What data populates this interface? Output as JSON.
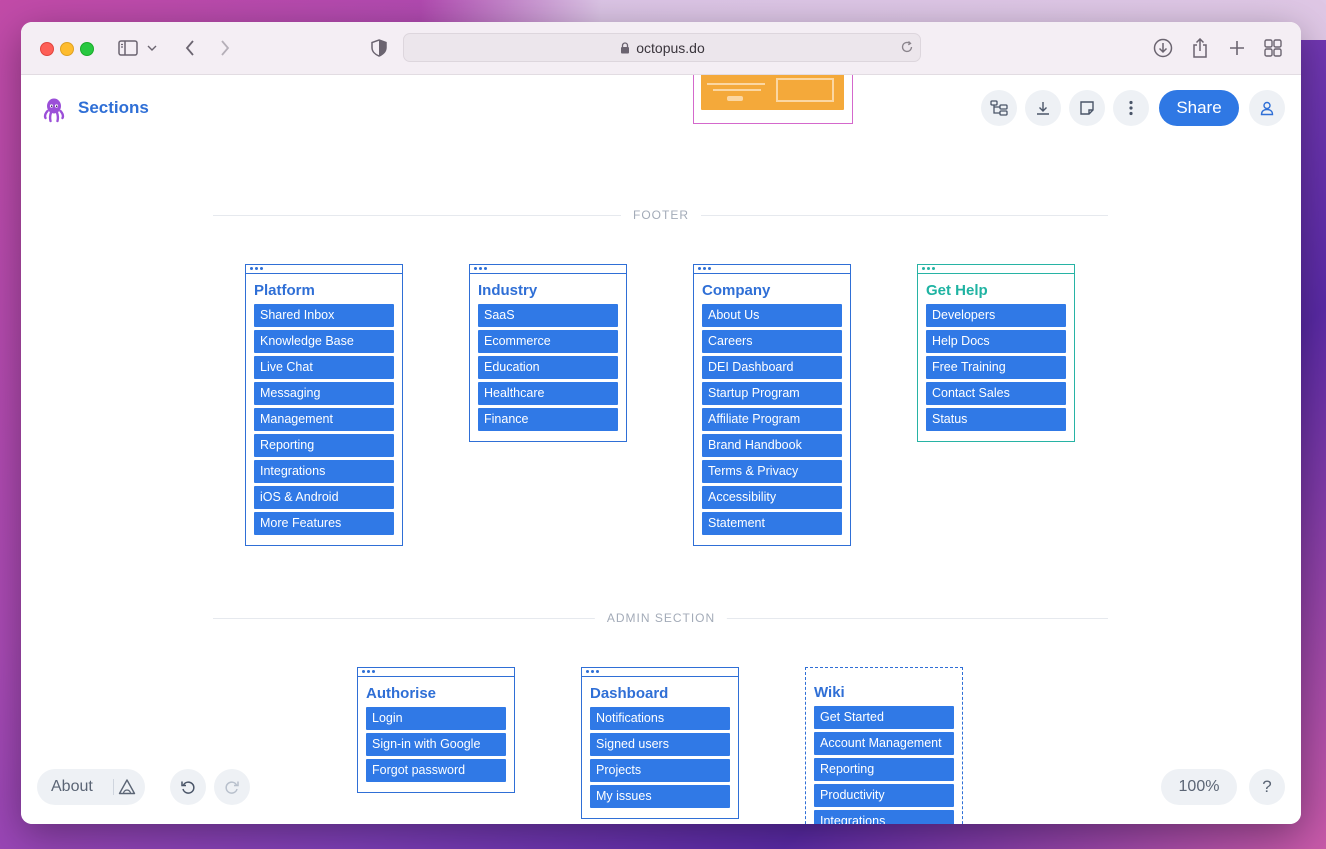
{
  "browser": {
    "url": "octopus.do"
  },
  "app": {
    "title": "Sections",
    "share_label": "Share"
  },
  "sections": {
    "footer_label": "FOOTER",
    "admin_label": "ADMIN SECTION"
  },
  "footer_cards": [
    {
      "title": "Platform",
      "items": [
        "Shared Inbox",
        "Knowledge Base",
        "Live Chat",
        "Messaging",
        "Management",
        "Reporting",
        "Integrations",
        "iOS & Android",
        "More Features"
      ]
    },
    {
      "title": "Industry",
      "items": [
        "SaaS",
        "Ecommerce",
        "Education",
        "Healthcare",
        "Finance"
      ]
    },
    {
      "title": "Company",
      "items": [
        "About Us",
        "Careers",
        "DEI Dashboard",
        "Startup Program",
        "Affiliate Program",
        "Brand Handbook",
        "Terms & Privacy",
        "Accessibility",
        "Statement"
      ]
    },
    {
      "title": "Get Help",
      "items": [
        "Developers",
        "Help Docs",
        "Free Training",
        "Contact Sales",
        "Status"
      ]
    }
  ],
  "admin_cards": [
    {
      "title": "Authorise",
      "items": [
        "Login",
        "Sign-in with Google",
        "Forgot password"
      ]
    },
    {
      "title": "Dashboard",
      "items": [
        "Notifications",
        "Signed users",
        "Projects",
        "My issues"
      ]
    },
    {
      "title": "Wiki",
      "items": [
        "Get Started",
        "Account Management",
        "Reporting",
        "Productivity",
        "Integrations"
      ]
    }
  ],
  "bottom": {
    "about_label": "About",
    "zoom_label": "100%",
    "help_label": "?"
  },
  "colors": {
    "accent": "#2f78e4",
    "teal": "#27b3a4",
    "item_bg": "#3079e6"
  }
}
